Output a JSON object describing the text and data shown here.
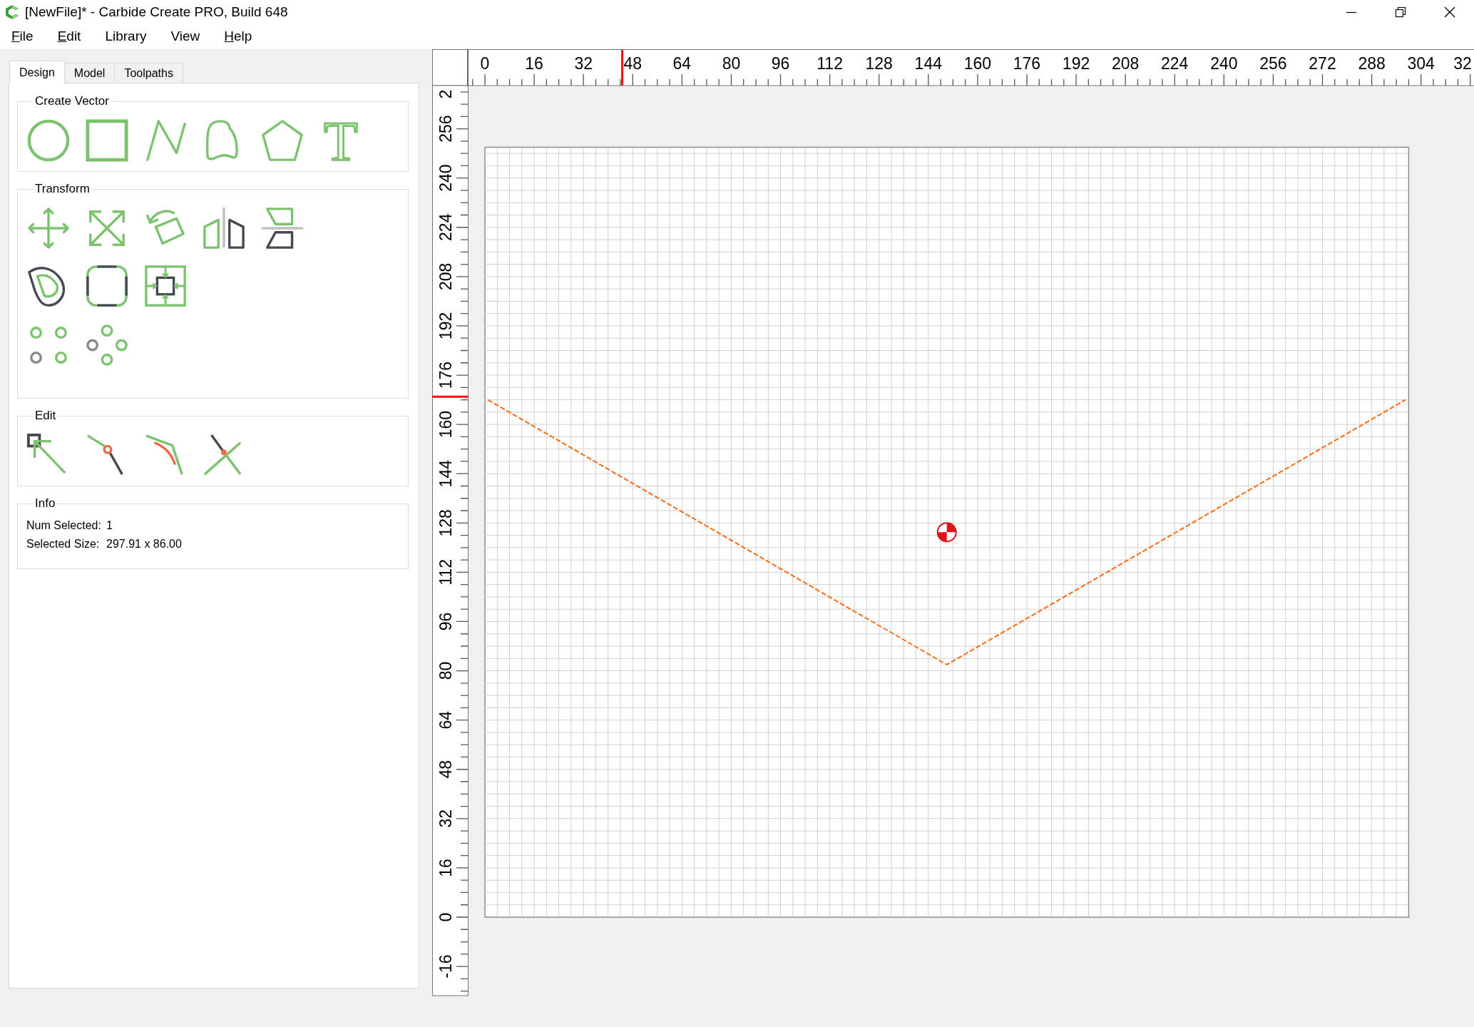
{
  "window": {
    "title": "[NewFile]* - Carbide Create PRO, Build 648"
  },
  "menu": [
    {
      "label": "File",
      "underlined": true
    },
    {
      "label": "Edit",
      "underlined": true
    },
    {
      "label": "Library",
      "underlined": false
    },
    {
      "label": "View",
      "underlined": false
    },
    {
      "label": "Help",
      "underlined": true
    }
  ],
  "tabs": [
    {
      "label": "Design",
      "selected": true
    },
    {
      "label": "Model",
      "selected": false
    },
    {
      "label": "Toolpaths",
      "selected": false
    }
  ],
  "groups": [
    {
      "kind": "tools",
      "title": "Create Vector",
      "rows": [
        [
          {
            "kind": "circle"
          },
          {
            "kind": "rectangle"
          },
          {
            "kind": "polyline"
          },
          {
            "kind": "curve"
          },
          {
            "kind": "polygon"
          },
          {
            "kind": "text",
            "glyph": "T"
          }
        ]
      ]
    },
    {
      "kind": "tools",
      "title": "Transform",
      "rows": [
        [
          {
            "kind": "move"
          },
          {
            "kind": "scale"
          },
          {
            "kind": "rotate"
          },
          {
            "kind": "mirror-h"
          },
          {
            "kind": "mirror-v"
          }
        ],
        [
          {
            "kind": "offset"
          },
          {
            "kind": "fillet-corners"
          },
          {
            "kind": "align"
          }
        ],
        [
          {
            "kind": "grid-array"
          },
          {
            "kind": "circular-array"
          }
        ]
      ]
    },
    {
      "kind": "tools",
      "title": "Edit",
      "rows": [
        [
          {
            "kind": "node-edit"
          },
          {
            "kind": "split"
          },
          {
            "kind": "fillet"
          },
          {
            "kind": "trim"
          }
        ]
      ]
    },
    {
      "kind": "info",
      "title": "Info",
      "fields": [
        {
          "label": "Num Selected:",
          "value": "1"
        },
        {
          "label": "Selected Size:",
          "value": "297.91 x 86.00"
        }
      ]
    }
  ],
  "canvas": {
    "x_ruler": {
      "labels": [
        "0",
        "16",
        "32",
        "48",
        "64",
        "80",
        "96",
        "112",
        "128",
        "144",
        "160",
        "176",
        "192",
        "208",
        "224",
        "240",
        "256",
        "272",
        "288",
        "304",
        "32"
      ]
    },
    "y_ruler": {
      "labels": [
        "2",
        "256",
        "240",
        "224",
        "208",
        "192",
        "176",
        "160",
        "144",
        "128",
        "112",
        "96",
        "80",
        "64",
        "48",
        "32",
        "16",
        "0",
        "-16"
      ]
    }
  }
}
